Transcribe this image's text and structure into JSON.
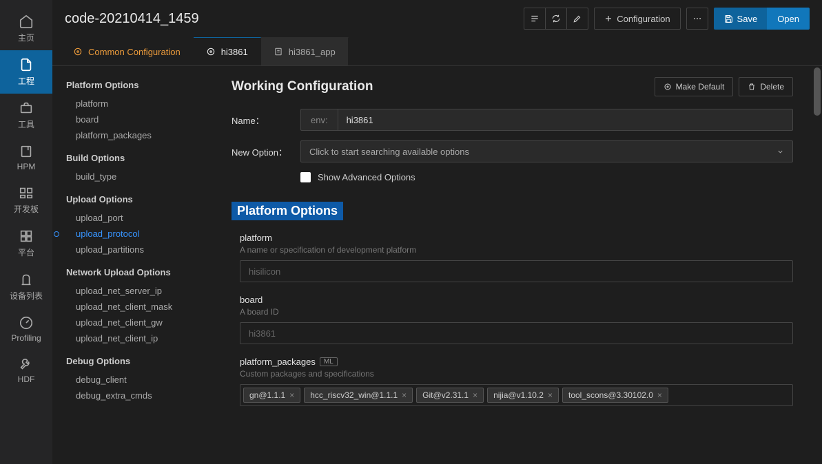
{
  "title": "code-20210414_1459",
  "header": {
    "configuration": "Configuration",
    "save": "Save",
    "open": "Open"
  },
  "tabs": {
    "common": "Common Configuration",
    "hi3861": "hi3861",
    "hi3861_app": "hi3861_app"
  },
  "nav": {
    "home": "主页",
    "project": "工程",
    "tools": "工具",
    "hpm": "HPM",
    "devboard": "开发板",
    "platform": "平台",
    "devicelist": "设备列表",
    "profiling": "Profiling",
    "hdf": "HDF"
  },
  "outline": {
    "platform_options": "Platform Options",
    "platform": "platform",
    "board": "board",
    "platform_packages": "platform_packages",
    "build_options": "Build Options",
    "build_type": "build_type",
    "upload_options": "Upload Options",
    "upload_port": "upload_port",
    "upload_protocol": "upload_protocol",
    "upload_partitions": "upload_partitions",
    "network_upload_options": "Network Upload Options",
    "upload_net_server_ip": "upload_net_server_ip",
    "upload_net_client_mask": "upload_net_client_mask",
    "upload_net_client_gw": "upload_net_client_gw",
    "upload_net_client_ip": "upload_net_client_ip",
    "debug_options": "Debug Options",
    "debug_client": "debug_client",
    "debug_extra_cmds": "debug_extra_cmds"
  },
  "form": {
    "working_config": "Working Configuration",
    "make_default": "Make Default",
    "delete": "Delete",
    "name_label": "Name：",
    "env_prefix": "env:",
    "name_value": "hi3861",
    "new_option_label": "New Option：",
    "new_option_placeholder": "Click to start searching available options",
    "show_advanced": "Show Advanced Options",
    "section_platform": "Platform Options",
    "platform": {
      "name": "platform",
      "desc": "A name or specification of development platform",
      "placeholder": "hisilicon"
    },
    "board": {
      "name": "board",
      "desc": "A board ID",
      "placeholder": "hi3861"
    },
    "platform_packages": {
      "name": "platform_packages",
      "ml": "ML",
      "desc": "Custom packages and specifications",
      "tags": [
        "gn@1.1.1",
        "hcc_riscv32_win@1.1.1",
        "Git@v2.31.1",
        "nijia@v1.10.2",
        "tool_scons@3.30102.0"
      ]
    }
  }
}
